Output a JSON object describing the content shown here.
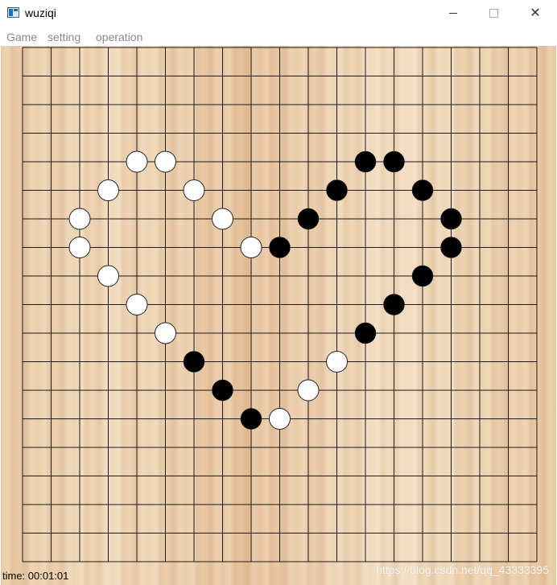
{
  "window": {
    "title": "wuziqi",
    "controls": [
      "minimize",
      "maximize",
      "close"
    ],
    "close_glyph": "✕"
  },
  "menu": {
    "items": [
      "Game",
      "setting",
      "operation"
    ]
  },
  "board": {
    "size": 19,
    "colors": {
      "black": "#000000",
      "white": "#ffffff",
      "line": "#1a1a1a"
    },
    "stones": [
      {
        "col": 4,
        "row": 4,
        "color": "white"
      },
      {
        "col": 5,
        "row": 4,
        "color": "white"
      },
      {
        "col": 3,
        "row": 5,
        "color": "white"
      },
      {
        "col": 6,
        "row": 5,
        "color": "white"
      },
      {
        "col": 2,
        "row": 6,
        "color": "white"
      },
      {
        "col": 7,
        "row": 6,
        "color": "white"
      },
      {
        "col": 2,
        "row": 7,
        "color": "white"
      },
      {
        "col": 8,
        "row": 7,
        "color": "white"
      },
      {
        "col": 3,
        "row": 8,
        "color": "white"
      },
      {
        "col": 4,
        "row": 9,
        "color": "white"
      },
      {
        "col": 5,
        "row": 10,
        "color": "white"
      },
      {
        "col": 11,
        "row": 11,
        "color": "white"
      },
      {
        "col": 10,
        "row": 12,
        "color": "white"
      },
      {
        "col": 9,
        "row": 13,
        "color": "white"
      },
      {
        "col": 12,
        "row": 4,
        "color": "black"
      },
      {
        "col": 13,
        "row": 4,
        "color": "black"
      },
      {
        "col": 11,
        "row": 5,
        "color": "black"
      },
      {
        "col": 14,
        "row": 5,
        "color": "black"
      },
      {
        "col": 10,
        "row": 6,
        "color": "black"
      },
      {
        "col": 15,
        "row": 6,
        "color": "black"
      },
      {
        "col": 9,
        "row": 7,
        "color": "black"
      },
      {
        "col": 15,
        "row": 7,
        "color": "black"
      },
      {
        "col": 14,
        "row": 8,
        "color": "black"
      },
      {
        "col": 13,
        "row": 9,
        "color": "black"
      },
      {
        "col": 12,
        "row": 10,
        "color": "black"
      },
      {
        "col": 6,
        "row": 11,
        "color": "black"
      },
      {
        "col": 7,
        "row": 12,
        "color": "black"
      },
      {
        "col": 8,
        "row": 13,
        "color": "black"
      }
    ]
  },
  "status": {
    "time_text": "time: 00:01:01",
    "watermark": "https://blog.csdn.net/qq_43333395"
  }
}
